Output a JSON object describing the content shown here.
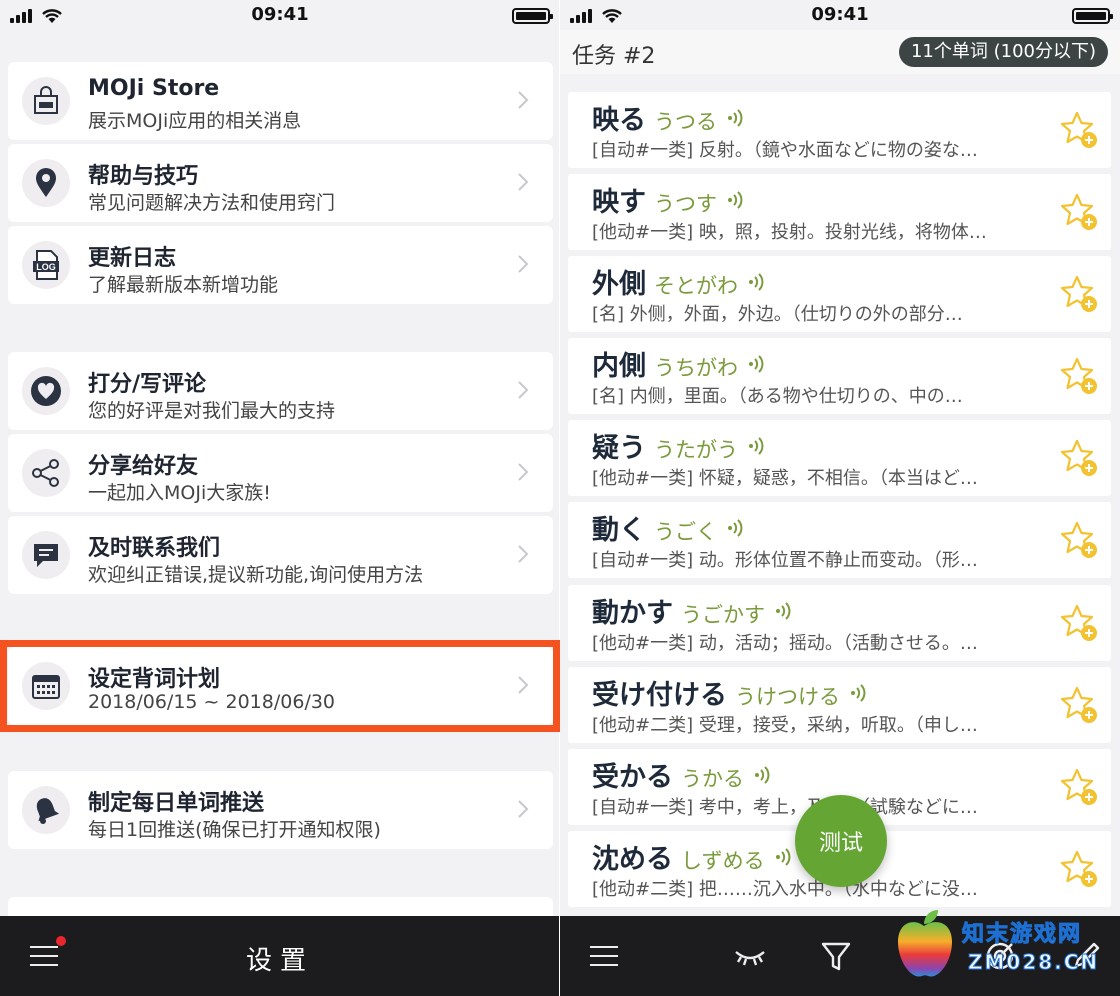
{
  "left": {
    "status": {
      "time": "09:41"
    },
    "settings": [
      {
        "id": "store",
        "title": "MOJi Store",
        "subtitle": "展示MOJi应用的相关消息",
        "icon": "store-bag-icon"
      },
      {
        "id": "help",
        "title": "帮助与技巧",
        "subtitle": "常见问题解决方法和使用窍门",
        "icon": "location-pin-icon"
      },
      {
        "id": "log",
        "title": "更新日志",
        "subtitle": "了解最新版本新增功能",
        "icon": "log-file-icon",
        "icon_text": "LOG"
      },
      {
        "id": "rate",
        "title": "打分/写评论",
        "subtitle": "您的好评是对我们最大的支持",
        "icon": "heart-icon"
      },
      {
        "id": "share",
        "title": "分享给好友",
        "subtitle": "一起加入MOJi大家族!",
        "icon": "share-icon"
      },
      {
        "id": "contact",
        "title": "及时联系我们",
        "subtitle": "欢迎纠正错误,提议新功能,询问使用方法",
        "icon": "chat-bubble-icon"
      },
      {
        "id": "plan",
        "title": "设定背词计划",
        "subtitle": "2018/06/15 ~ 2018/06/30",
        "icon": "calendar-icon"
      },
      {
        "id": "push",
        "title": "制定每日单词推送",
        "subtitle": "每日1回推送(确保已打开通知权限)",
        "icon": "bell-icon"
      }
    ],
    "bottom_bar": {
      "title": "设置"
    },
    "accent_highlight": "#f4521e"
  },
  "right": {
    "status": {
      "time": "09:41"
    },
    "task": {
      "title": "任务 #2",
      "badge": "11个单词 (100分以下)"
    },
    "words": [
      {
        "kanji": "映る",
        "kana": "うつる",
        "definition": "[自动#一类] 反射。（鏡や水面などに物の姿な…"
      },
      {
        "kanji": "映す",
        "kana": "うつす",
        "definition": "[他动#一类] 映，照，投射。投射光线，将物体…"
      },
      {
        "kanji": "外側",
        "kana": "そとがわ",
        "definition": "[名] 外侧，外面，外边。（仕切りの外の部分…"
      },
      {
        "kanji": "内側",
        "kana": "うちがわ",
        "definition": "[名] 内侧，里面。（ある物や仕切りの、中の…"
      },
      {
        "kanji": "疑う",
        "kana": "うたがう",
        "definition": "[他动#一类] 怀疑，疑惑，不相信。（本当はど…"
      },
      {
        "kanji": "動く",
        "kana": "うごく",
        "definition": "[自动#一类] 动。形体位置不静止而变动。（形…"
      },
      {
        "kanji": "動かす",
        "kana": "うごかす",
        "definition": "[他动#一类] 动，活动；摇动。（活動させる。…"
      },
      {
        "kanji": "受け付ける",
        "kana": "うけつける",
        "definition": "[他动#二类] 受理，接受，采纳，听取。（申し…"
      },
      {
        "kanji": "受かる",
        "kana": "うかる",
        "definition": "[自动#一类] 考中，考上，及格。（試験などに…"
      },
      {
        "kanji": "沈める",
        "kana": "しずめる",
        "definition": "[他动#二类] 把……沉入水中。（水中などに没…"
      }
    ],
    "fab_label": "测试",
    "colors": {
      "kana": "#7a9b3c",
      "fab": "#64a534",
      "star_badge": "#f2c230"
    },
    "watermark": {
      "line1": "知末游戏网",
      "line2": "ZM028.CN"
    }
  }
}
